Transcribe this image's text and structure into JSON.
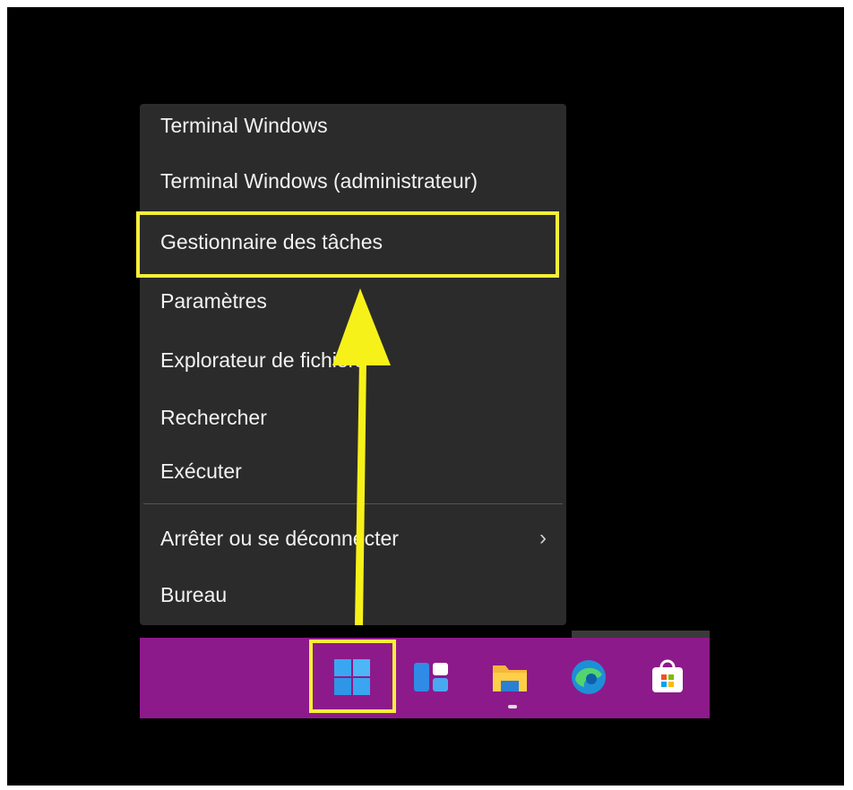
{
  "context_menu": {
    "items": [
      {
        "label": "Terminal Windows"
      },
      {
        "label": "Terminal Windows (administrateur)"
      },
      {
        "label": "Gestionnaire des tâches"
      },
      {
        "label": "Paramètres"
      },
      {
        "label": "Explorateur de fichiers"
      },
      {
        "label": "Rechercher"
      },
      {
        "label": "Exécuter"
      },
      {
        "label": "Arrêter ou se déconnecter",
        "chevron": "›"
      },
      {
        "label": "Bureau"
      }
    ]
  },
  "taskbar": {
    "icons": [
      "windows-start-icon",
      "widgets-icon",
      "file-explorer-icon",
      "edge-icon",
      "store-icon"
    ],
    "background": "#8d1a8a"
  },
  "annotation": {
    "highlight_color": "#f7ef3a"
  }
}
